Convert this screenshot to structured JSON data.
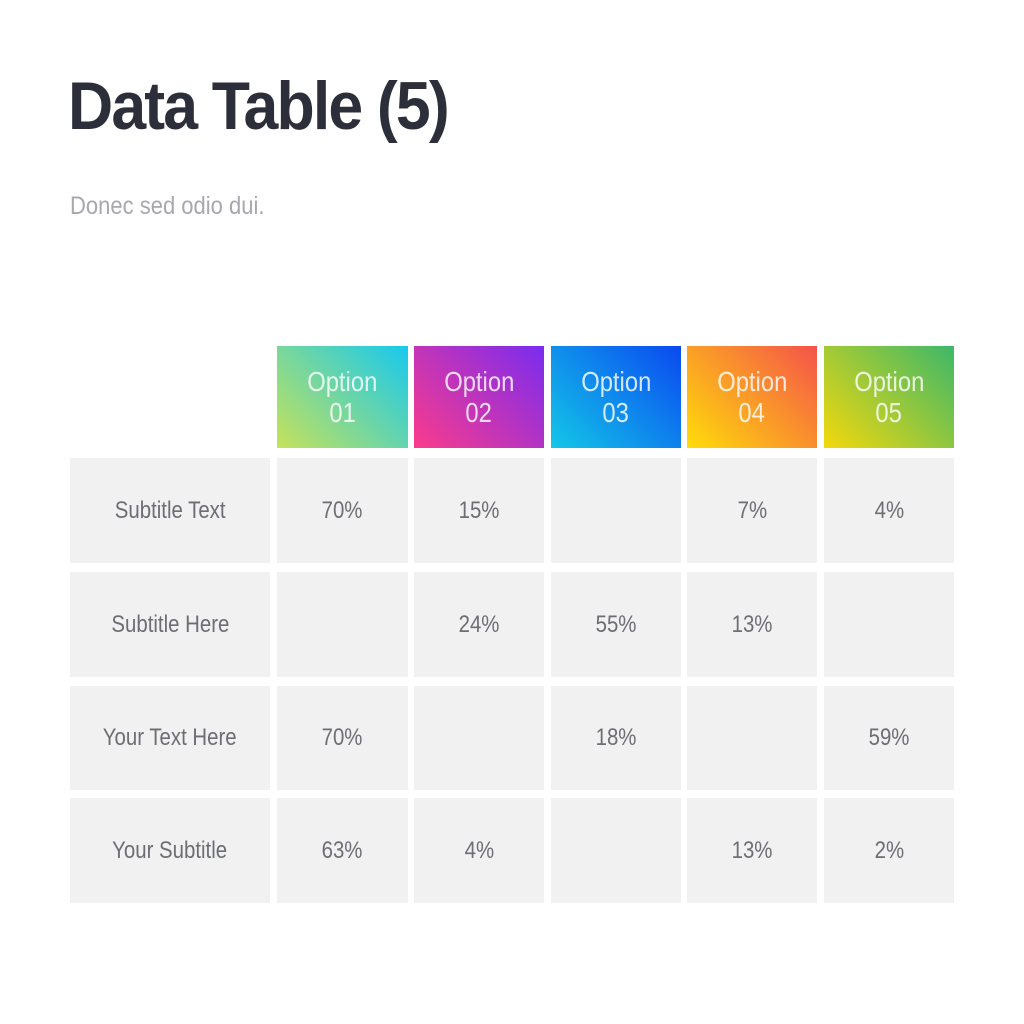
{
  "page": {
    "title": "Data Table (5)",
    "subtitle": "Donec sed odio dui."
  },
  "table": {
    "columns": [
      {
        "label": "Option 01",
        "line1": "Option",
        "line2": "01",
        "gradient": [
          "#c6e25a",
          "#17c9ef"
        ]
      },
      {
        "label": "Option 02",
        "line1": "Option",
        "line2": "02",
        "gradient": [
          "#fb3b8c",
          "#7a2cf0"
        ]
      },
      {
        "label": "Option 03",
        "line1": "Option",
        "line2": "03",
        "gradient": [
          "#13c7e8",
          "#0a49f0"
        ]
      },
      {
        "label": "Option 04",
        "line1": "Option",
        "line2": "04",
        "gradient": [
          "#ffdc0a",
          "#f5534a"
        ]
      },
      {
        "label": "Option 05",
        "line1": "Option",
        "line2": "05",
        "gradient": [
          "#f4d80c",
          "#3db86a"
        ]
      }
    ],
    "rows": [
      {
        "label": "Subtitle Text",
        "values": [
          "70%",
          "15%",
          "",
          "7%",
          "4%"
        ]
      },
      {
        "label": "Subtitle Here",
        "values": [
          "",
          "24%",
          "55%",
          "13%",
          ""
        ]
      },
      {
        "label": "Your Text Here",
        "values": [
          "70%",
          "",
          "18%",
          "",
          "59%"
        ]
      },
      {
        "label": "Your Subtitle",
        "values": [
          "63%",
          "4%",
          "",
          "13%",
          "2%"
        ]
      }
    ]
  }
}
